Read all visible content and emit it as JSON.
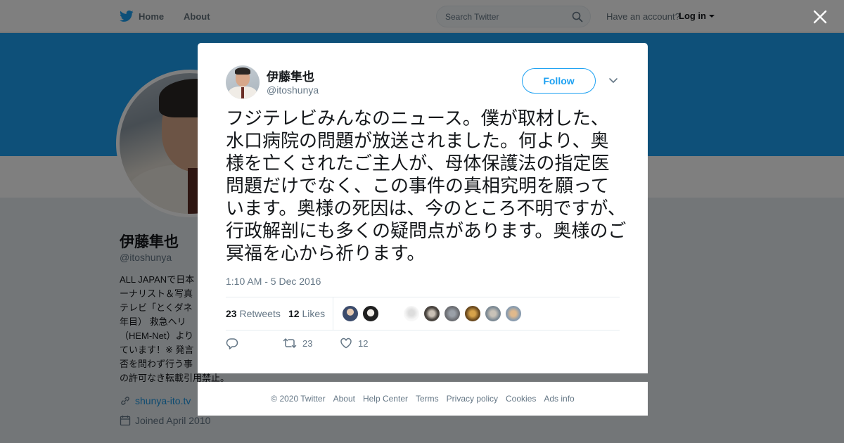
{
  "nav": {
    "home_label": "Home",
    "about_label": "About",
    "search_placeholder": "Search Twitter",
    "have_account": "Have an account?",
    "login_label": "Log in",
    "brand_color": "#1da1f2"
  },
  "profile": {
    "name": "伊藤隼也",
    "handle": "@itoshunya",
    "bio_lines": [
      "ALL JAPANで日本",
      "ーナリスト＆写真",
      "テレビ「とくダネ",
      "年目） 救急ヘリ",
      "（HEM-Net）より",
      "ています！※ 発言",
      "否を問わず行う事",
      "の許可なき転載引用禁止。"
    ],
    "link": "shunya-ito.tv",
    "joined": "Joined April 2010"
  },
  "tweet": {
    "author_name": "伊藤隼也",
    "author_handle": "@itoshunya",
    "follow_label": "Follow",
    "text": "フジテレビみんなのニュース。僕が取材した、水口病院の問題が放送されました。何より、奥様を亡くされたご主人が、母体保護法の指定医問題だけでなく、この事件の真相究明を願っています。奥様の死因は、今のところ不明ですが、行政解剖にも多くの疑問点があります。奥様のご冥福を心から祈ります。",
    "timestamp": "1:10 AM - 5 Dec 2016",
    "retweets_count": "23",
    "retweets_label": "Retweets",
    "likes_count": "12",
    "likes_label": "Likes",
    "reply_count": "",
    "retweet_action_count": "23",
    "like_action_count": "12",
    "icons": [
      "reply-icon",
      "retweet-icon",
      "like-icon",
      "more-options-icon",
      "close-icon"
    ]
  },
  "footer": {
    "links": [
      "© 2020 Twitter",
      "About",
      "Help Center",
      "Terms",
      "Privacy policy",
      "Cookies",
      "Ads info"
    ]
  }
}
